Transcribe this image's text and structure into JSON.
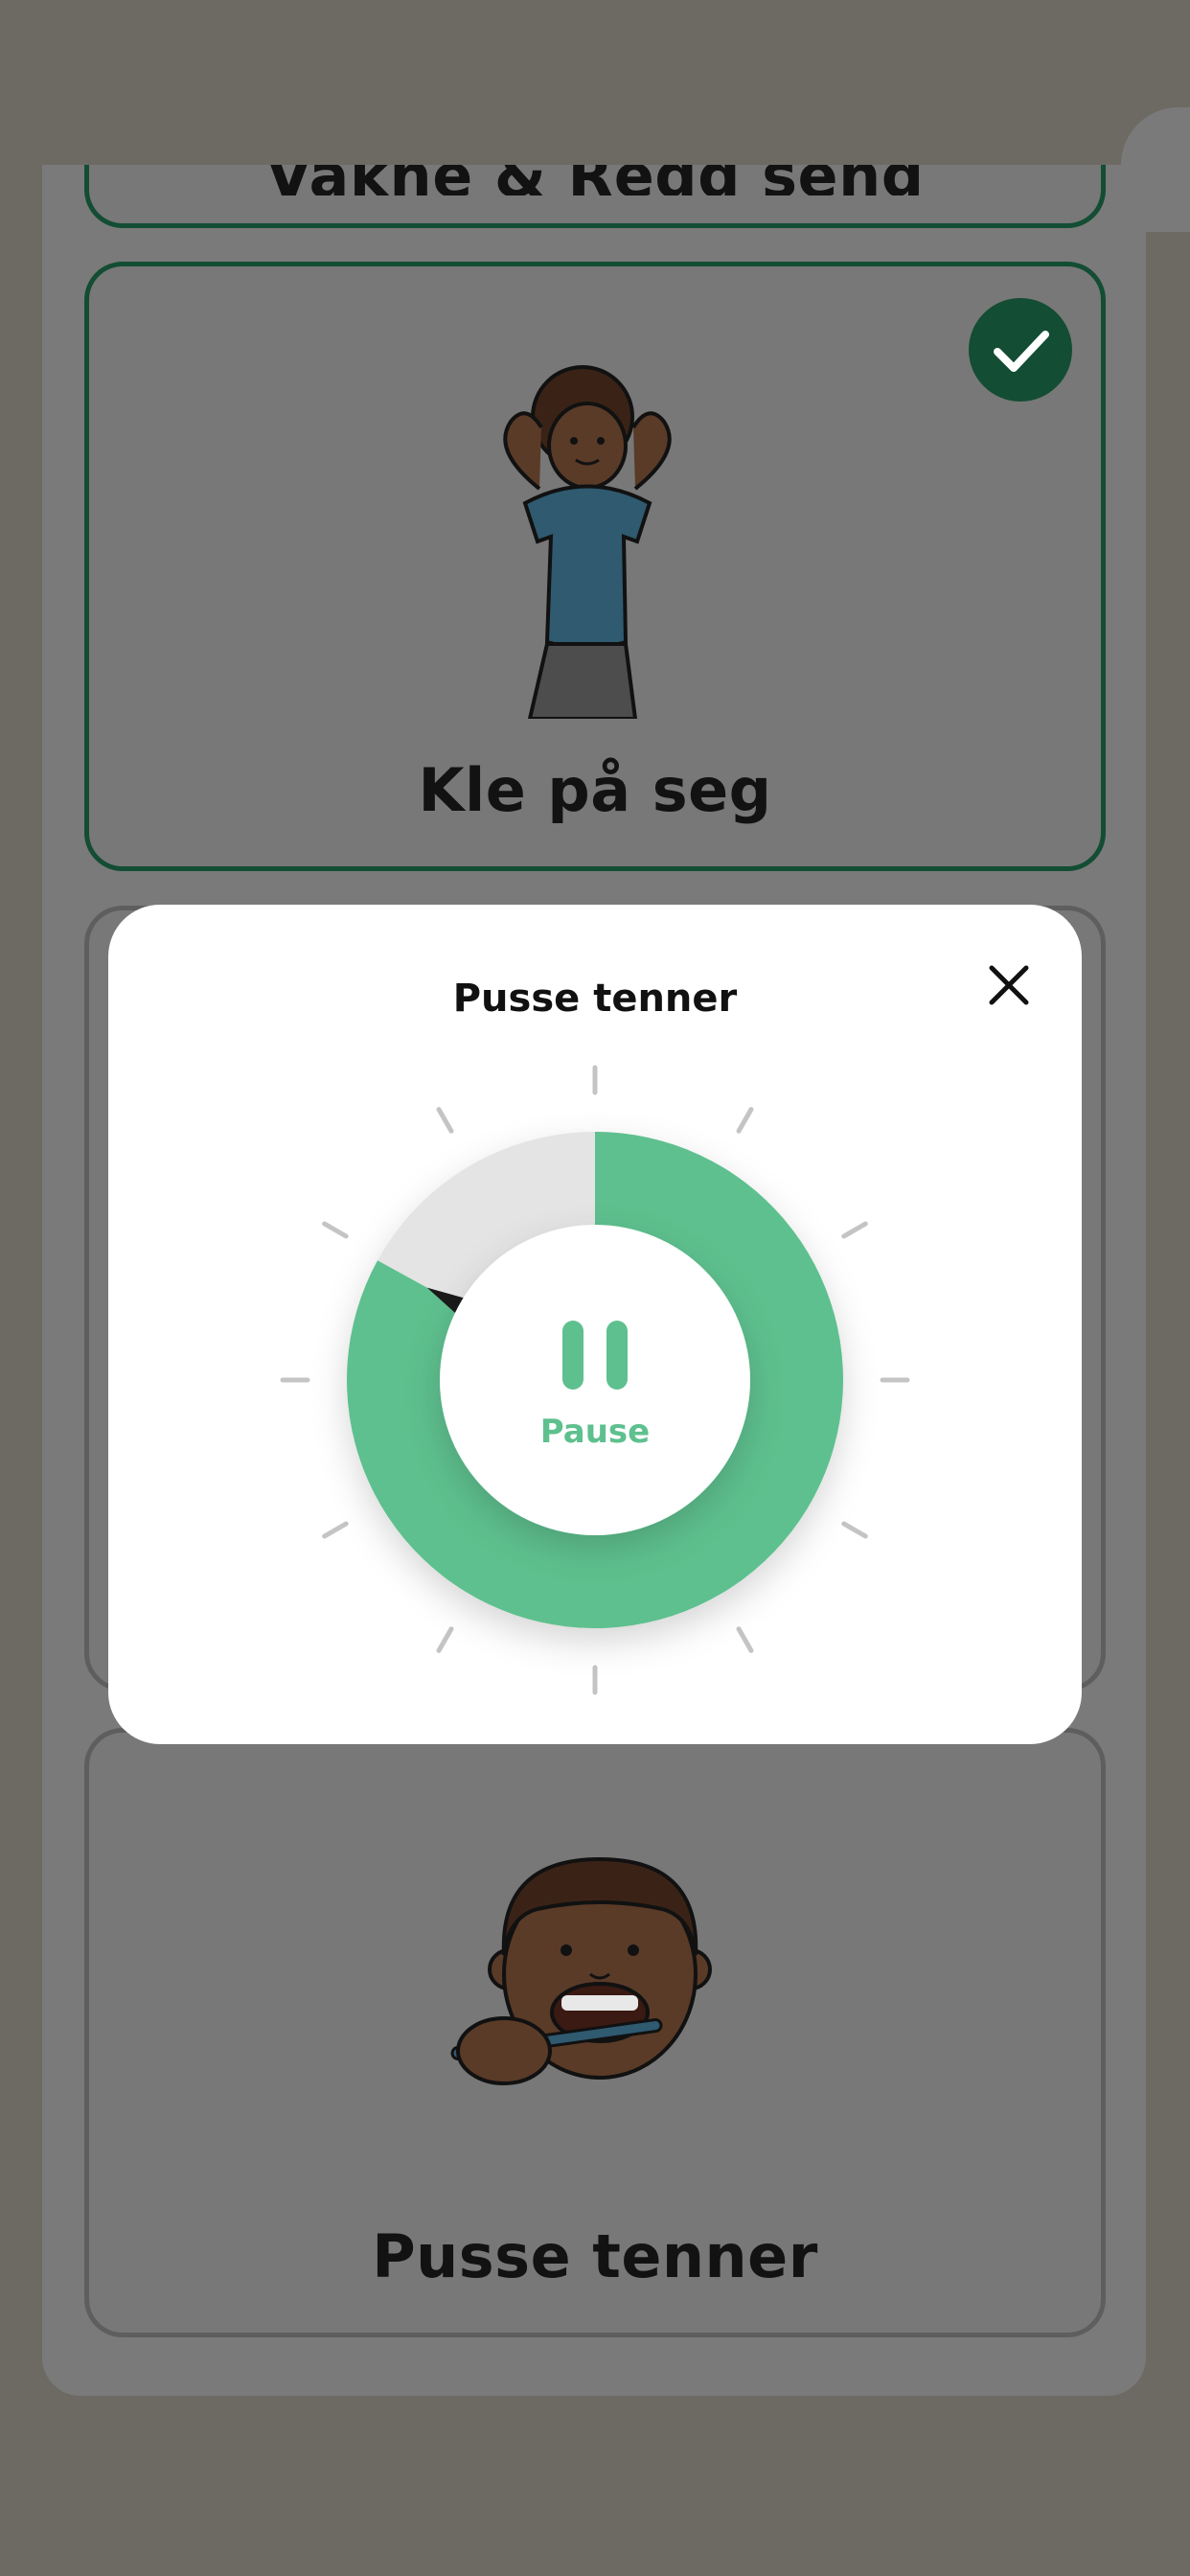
{
  "routine": {
    "cards": [
      {
        "title": "Vakne & Redd seng",
        "completed": false,
        "illustration": "bed-illustration"
      },
      {
        "title": "Kle på seg",
        "completed": true,
        "illustration": "boy-dressing-illustration"
      },
      {
        "title": "",
        "completed": false,
        "illustration": ""
      },
      {
        "title": "Pusse tenner",
        "completed": false,
        "illustration": "boy-brushing-teeth-illustration"
      }
    ]
  },
  "timer_dialog": {
    "title": "Pusse tenner",
    "close_icon": "close-icon",
    "pause_label": "Pause",
    "pause_icon": "pause-icon",
    "progress_elapsed_fraction": 0.17,
    "tick_count": 12
  },
  "colors": {
    "accent_green": "#5ec08e",
    "done_green": "#134d33",
    "track_gray": "#e4e4e4",
    "overlay": "#6d6a64"
  }
}
